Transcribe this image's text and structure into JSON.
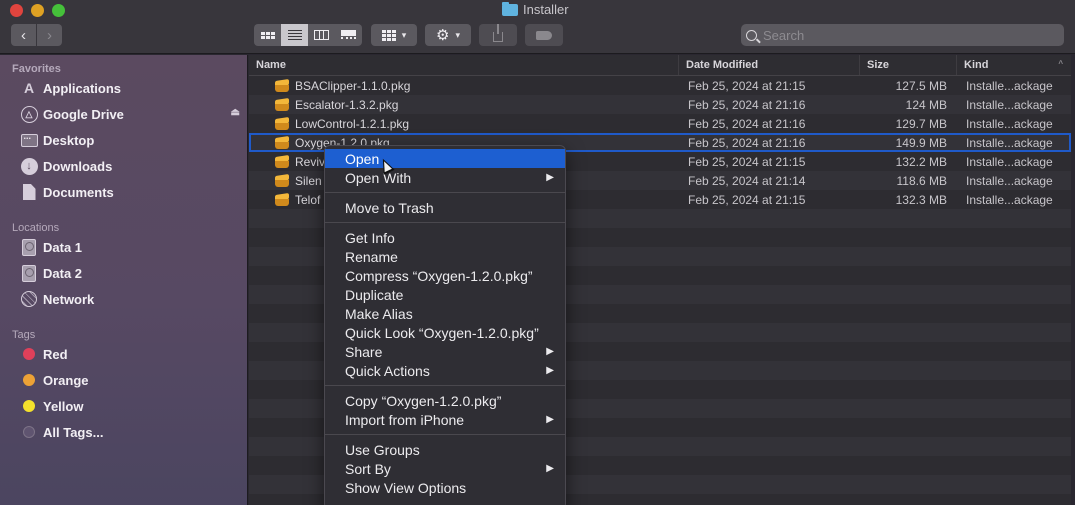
{
  "window": {
    "title": "Installer",
    "title_icon": "folder-icon"
  },
  "toolbar": {
    "back_glyph": "‹",
    "forward_glyph": "›",
    "view_modes": [
      {
        "name": "icon-view",
        "active": false
      },
      {
        "name": "list-view",
        "active": true
      },
      {
        "name": "column-view",
        "active": false
      },
      {
        "name": "gallery-view",
        "active": false
      }
    ],
    "group_glyph": "▾",
    "action_glyph": "⚙",
    "search": {
      "placeholder": "Search",
      "value": ""
    }
  },
  "sidebar": {
    "sections": [
      {
        "title": "Favorites",
        "items": [
          {
            "label": "Applications",
            "icon": "applications-icon"
          },
          {
            "label": "Google Drive",
            "icon": "google-drive-icon",
            "eject": "⏏"
          },
          {
            "label": "Desktop",
            "icon": "desktop-icon"
          },
          {
            "label": "Downloads",
            "icon": "downloads-icon"
          },
          {
            "label": "Documents",
            "icon": "documents-icon"
          }
        ]
      },
      {
        "title": "Locations",
        "items": [
          {
            "label": "Data 1",
            "icon": "disk-icon"
          },
          {
            "label": "Data 2",
            "icon": "disk-icon"
          },
          {
            "label": "Network",
            "icon": "network-icon"
          }
        ]
      },
      {
        "title": "Tags",
        "items": [
          {
            "label": "Red",
            "color": "#e0405a"
          },
          {
            "label": "Orange",
            "color": "#eda236"
          },
          {
            "label": "Yellow",
            "color": "#f4e12c"
          },
          {
            "label": "All Tags...",
            "color": ""
          }
        ]
      }
    ]
  },
  "filelist": {
    "columns": [
      "Name",
      "Date Modified",
      "Size",
      "Kind"
    ],
    "sort_indicator": "^",
    "rows": [
      {
        "name": "BSAClipper-1.1.0.pkg",
        "date": "Feb 25, 2024 at 21:15",
        "size": "127.5 MB",
        "kind": "Installe...ackage"
      },
      {
        "name": "Escalator-1.3.2.pkg",
        "date": "Feb 25, 2024 at 21:16",
        "size": "124 MB",
        "kind": "Installe...ackage"
      },
      {
        "name": "LowControl-1.2.1.pkg",
        "date": "Feb 25, 2024 at 21:16",
        "size": "129.7 MB",
        "kind": "Installe...ackage"
      },
      {
        "name": "Oxygen-1.2.0.pkg",
        "date": "Feb 25, 2024 at 21:16",
        "size": "149.9 MB",
        "kind": "Installe...ackage",
        "selected": true
      },
      {
        "name": "Reviv",
        "date": "Feb 25, 2024 at 21:15",
        "size": "132.2 MB",
        "kind": "Installe...ackage"
      },
      {
        "name": "Silen",
        "date": "Feb 25, 2024 at 21:14",
        "size": "118.6 MB",
        "kind": "Installe...ackage"
      },
      {
        "name": "Telof",
        "date": "Feb 25, 2024 at 21:15",
        "size": "132.3 MB",
        "kind": "Installe...ackage"
      }
    ]
  },
  "context_menu": {
    "groups": [
      [
        {
          "label": "Open",
          "highlighted": true
        },
        {
          "label": "Open With",
          "submenu": true
        }
      ],
      [
        {
          "label": "Move to Trash"
        }
      ],
      [
        {
          "label": "Get Info"
        },
        {
          "label": "Rename"
        },
        {
          "label": "Compress “Oxygen-1.2.0.pkg”"
        },
        {
          "label": "Duplicate"
        },
        {
          "label": "Make Alias"
        },
        {
          "label": "Quick Look “Oxygen-1.2.0.pkg”"
        },
        {
          "label": "Share",
          "submenu": true
        },
        {
          "label": "Quick Actions",
          "submenu": true
        }
      ],
      [
        {
          "label": "Copy “Oxygen-1.2.0.pkg”"
        },
        {
          "label": "Import from iPhone",
          "submenu": true
        }
      ],
      [
        {
          "label": "Use Groups"
        },
        {
          "label": "Sort By",
          "submenu": true
        },
        {
          "label": "Show View Options"
        }
      ]
    ],
    "submenu_glyph": "▶"
  }
}
